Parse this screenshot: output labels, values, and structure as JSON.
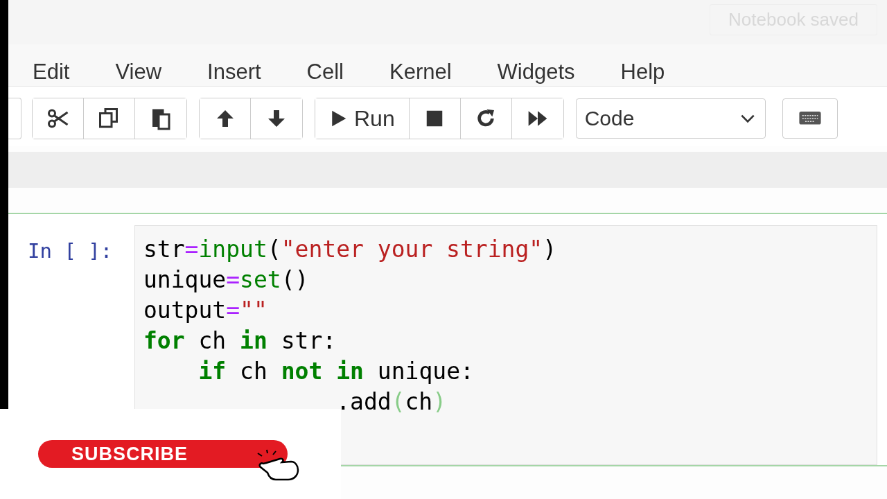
{
  "header": {
    "status": "Notebook saved"
  },
  "menu": [
    "Edit",
    "View",
    "Insert",
    "Cell",
    "Kernel",
    "Widgets",
    "Help"
  ],
  "toolbar": {
    "run_label": "Run",
    "cell_type": "Code"
  },
  "cell": {
    "prompt": "In [ ]:",
    "lines": [
      [
        {
          "kind": "name",
          "text": "str"
        },
        {
          "kind": "op",
          "text": "="
        },
        {
          "kind": "builtin",
          "text": "input"
        },
        {
          "kind": "punct",
          "text": "("
        },
        {
          "kind": "string",
          "text": "\"enter your string\""
        },
        {
          "kind": "punct",
          "text": ")"
        }
      ],
      [
        {
          "kind": "name",
          "text": "unique"
        },
        {
          "kind": "op",
          "text": "="
        },
        {
          "kind": "builtin",
          "text": "set"
        },
        {
          "kind": "punct",
          "text": "()"
        }
      ],
      [
        {
          "kind": "name",
          "text": "output"
        },
        {
          "kind": "op",
          "text": "="
        },
        {
          "kind": "string",
          "text": "\"\""
        }
      ],
      [
        {
          "kind": "keyword",
          "text": "for"
        },
        {
          "kind": "name",
          "text": " ch "
        },
        {
          "kind": "keyword",
          "text": "in"
        },
        {
          "kind": "name",
          "text": " str:"
        }
      ],
      [
        {
          "kind": "keyword",
          "text": "    if"
        },
        {
          "kind": "name",
          "text": " ch "
        },
        {
          "kind": "keyword",
          "text": "not in"
        },
        {
          "kind": "name",
          "text": " unique:"
        }
      ],
      [
        {
          "kind": "name",
          "text": "              .add"
        },
        {
          "kind": "match",
          "text": "("
        },
        {
          "kind": "name",
          "text": "ch"
        },
        {
          "kind": "match",
          "text": ")"
        }
      ]
    ]
  },
  "overlay": {
    "button": "SUBSCRIBE"
  }
}
